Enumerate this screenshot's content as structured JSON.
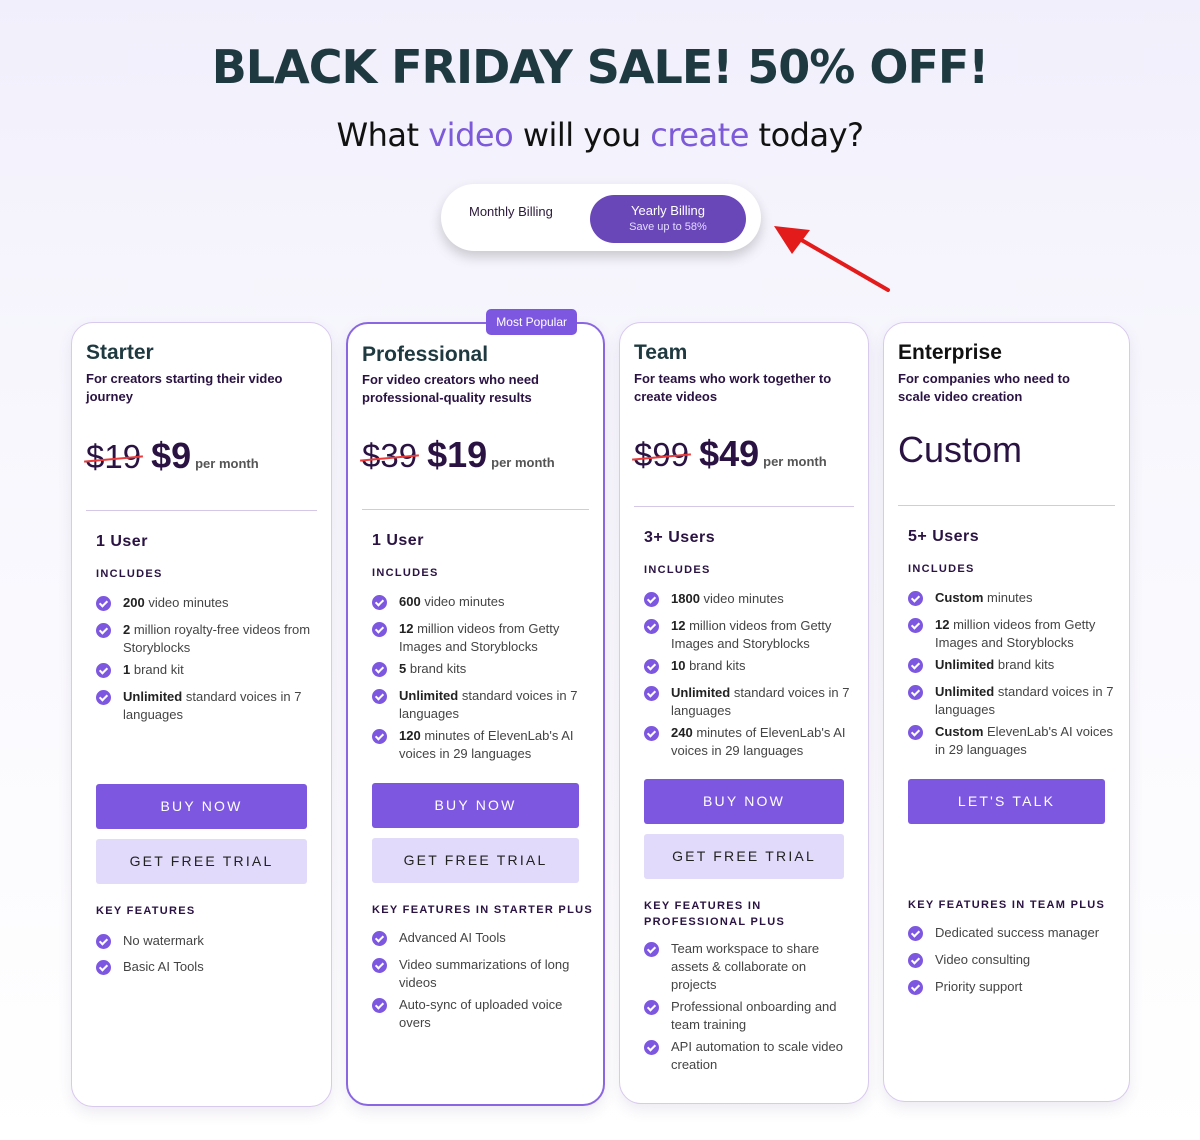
{
  "header": {
    "headline": "BLACK FRIDAY SALE! 50% OFF!",
    "subhead_parts": [
      "What ",
      "video",
      " will you ",
      "create",
      " today?"
    ]
  },
  "billing": {
    "monthly_label": "Monthly Billing",
    "yearly_label": "Yearly Billing",
    "yearly_note": "Save up to 58%",
    "selected": "yearly"
  },
  "colors": {
    "accent": "#7d57e0",
    "toggle_active": "#6a47b9",
    "headline": "#1e3a40",
    "strike": "#ea3a3a",
    "annotation_arrow": "#e31b1b"
  },
  "plans": [
    {
      "name": "Starter",
      "description": "For creators starting their video journey",
      "old_price": "$19",
      "price": "$9",
      "period": "per month",
      "users": "1 User",
      "includes_label": "INCLUDES",
      "includes": [
        {
          "bold": "200",
          "text": " video minutes"
        },
        {
          "bold": "2",
          "text": " million royalty-free videos from Storyblocks"
        },
        {
          "bold": "1",
          "text": " brand kit"
        },
        {
          "bold": "Unlimited",
          "text": " standard voices in 7 languages"
        }
      ],
      "buy_label": "BUY NOW",
      "trial_label": "GET FREE TRIAL",
      "features_label": "KEY FEATURES",
      "features": [
        "No watermark",
        "Basic AI Tools"
      ]
    },
    {
      "name": "Professional",
      "badge": "Most Popular",
      "description": "For video creators who need professional-quality results",
      "old_price": "$39",
      "price": "$19",
      "period": "per month",
      "users": "1 User",
      "includes_label": "INCLUDES",
      "includes": [
        {
          "bold": "600",
          "text": " video minutes"
        },
        {
          "bold": "12",
          "text": " million videos from Getty Images and Storyblocks"
        },
        {
          "bold": "5",
          "text": " brand kits"
        },
        {
          "bold": "Unlimited",
          "text": " standard voices in 7 languages"
        },
        {
          "bold": "120",
          "text": " minutes of ElevenLab's AI voices in 29 languages"
        }
      ],
      "buy_label": "BUY NOW",
      "trial_label": "GET FREE TRIAL",
      "features_label": "KEY FEATURES IN STARTER PLUS",
      "features": [
        "Advanced AI Tools",
        "Video summarizations of long videos",
        "Auto-sync of uploaded voice overs"
      ]
    },
    {
      "name": "Team",
      "description": "For teams who work together to create videos",
      "old_price": "$99",
      "price": "$49",
      "period": "per month",
      "users": "3+ Users",
      "includes_label": "INCLUDES",
      "includes": [
        {
          "bold": "1800",
          "text": " video minutes"
        },
        {
          "bold": "12",
          "text": " million videos from Getty Images and Storyblocks"
        },
        {
          "bold": "10",
          "text": " brand kits"
        },
        {
          "bold": "Unlimited",
          "text": " standard voices in 7 languages"
        },
        {
          "bold": "240",
          "text": " minutes of ElevenLab's AI voices in 29 languages"
        }
      ],
      "buy_label": "BUY NOW",
      "trial_label": "GET FREE TRIAL",
      "features_label": "KEY FEATURES IN PROFESSIONAL PLUS",
      "features": [
        "Team workspace to share assets & collaborate on projects",
        "Professional onboarding and team training",
        "API automation to scale video creation"
      ]
    },
    {
      "name": "Enterprise",
      "description": "For companies who need  to scale video creation",
      "custom_price": "Custom",
      "users": "5+ Users",
      "includes_label": "INCLUDES",
      "includes": [
        {
          "bold": "Custom",
          "text": " minutes"
        },
        {
          "bold": "12",
          "text": " million videos from Getty Images and Storyblocks"
        },
        {
          "bold": "Unlimited",
          "text": " brand kits"
        },
        {
          "bold": "Unlimited",
          "text": " standard voices in 7 languages"
        },
        {
          "bold": "Custom",
          "text": " ElevenLab's AI voices in 29 languages"
        }
      ],
      "talk_label": "LET'S TALK",
      "features_label": "KEY FEATURES IN TEAM PLUS",
      "features": [
        "Dedicated success manager",
        "Video consulting",
        "Priority support"
      ]
    }
  ]
}
